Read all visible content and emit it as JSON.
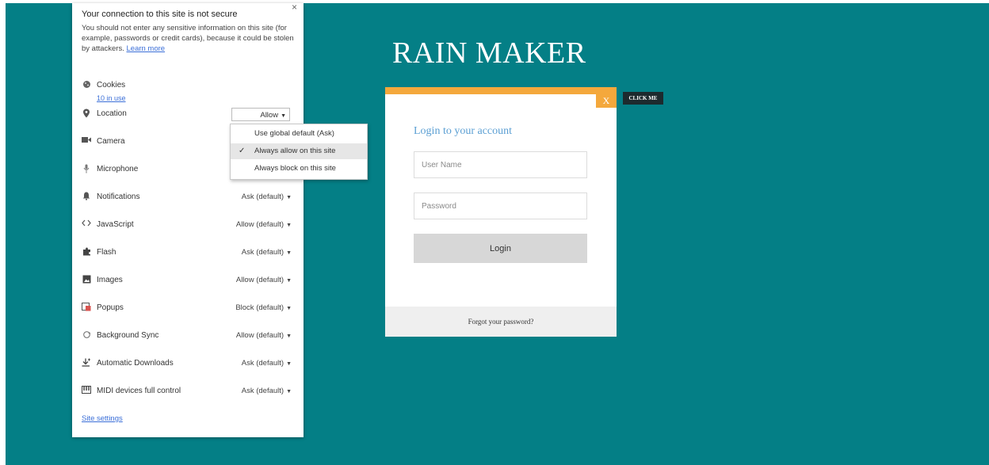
{
  "popup": {
    "close_label": "×",
    "title": "Your connection to this site is not secure",
    "warning_text": "You should not enter any sensitive information on this site (for example, passwords or credit cards), because it could be stolen by attackers.",
    "learn_more": "Learn more",
    "cookies": {
      "label": "Cookies",
      "sub": "10 in use",
      "icon": "cookie-icon"
    },
    "location": {
      "label": "Location",
      "value": "Allow",
      "icon": "location-pin-icon"
    },
    "location_menu": {
      "options": [
        "Use global default (Ask)",
        "Always allow on this site",
        "Always block on this site"
      ],
      "selected_index": 1,
      "check_mark": "✓"
    },
    "permissions": [
      {
        "label": "Camera",
        "value": "",
        "icon": "camera-icon"
      },
      {
        "label": "Microphone",
        "value": "",
        "icon": "microphone-icon"
      },
      {
        "label": "Notifications",
        "value": "Ask (default)",
        "icon": "bell-icon"
      },
      {
        "label": "JavaScript",
        "value": "Allow (default)",
        "icon": "code-icon"
      },
      {
        "label": "Flash",
        "value": "Ask (default)",
        "icon": "puzzle-icon"
      },
      {
        "label": "Images",
        "value": "Allow (default)",
        "icon": "image-icon"
      },
      {
        "label": "Popups",
        "value": "Block (default)",
        "icon": "popup-icon"
      },
      {
        "label": "Background Sync",
        "value": "Allow (default)",
        "icon": "sync-icon"
      },
      {
        "label": "Automatic Downloads",
        "value": "Ask (default)",
        "icon": "download-icon"
      },
      {
        "label": "MIDI devices full control",
        "value": "Ask (default)",
        "icon": "midi-icon"
      }
    ],
    "site_settings": "Site settings"
  },
  "brand": {
    "title": "RAIN MAKER"
  },
  "login": {
    "close_label": "X",
    "click_me": "CLICK ME",
    "heading": "Login to your account",
    "username_placeholder": "User Name",
    "password_placeholder": "Password",
    "button_label": "Login",
    "forgot_password": "Forgot your password?"
  },
  "colors": {
    "background": "#047f86",
    "accent": "#f4a83c",
    "heading": "#5b9fd3",
    "link": "#3b6fd8"
  }
}
